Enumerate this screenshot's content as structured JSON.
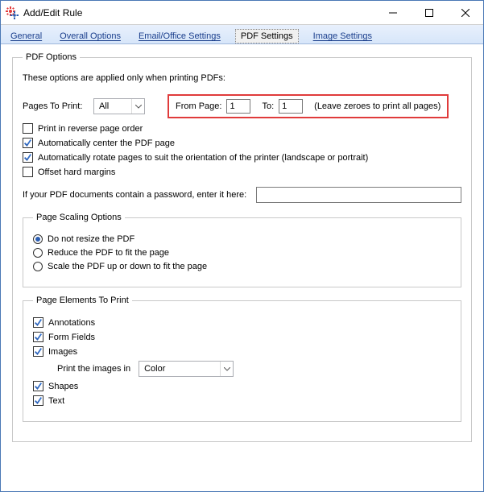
{
  "window": {
    "title": "Add/Edit Rule"
  },
  "tabs": {
    "general": "General",
    "overall": "Overall Options",
    "email": "Email/Office Settings",
    "pdf": "PDF Settings",
    "image": "Image Settings"
  },
  "pdf": {
    "group_title": "PDF Options",
    "intro": "These options are applied only when printing PDFs:",
    "pages_to_print_label": "Pages To Print:",
    "pages_to_print_value": "All",
    "from_label": "From Page:",
    "from_value": "1",
    "to_label": "To:",
    "to_value": "1",
    "range_hint": "(Leave zeroes to print all pages)",
    "reverse_label": "Print in reverse page order",
    "center_label": "Automatically center the PDF page",
    "rotate_label": "Automatically rotate pages to suit the orientation of the printer (landscape or portrait)",
    "offset_label": "Offset hard margins",
    "password_label": "If your PDF documents contain a password, enter it here:",
    "password_value": "",
    "scaling": {
      "group_title": "Page Scaling Options",
      "no_resize": "Do not resize the PDF",
      "reduce": "Reduce the PDF to fit the page",
      "scale": "Scale the PDF up or down to fit the page"
    },
    "elements": {
      "group_title": "Page Elements To Print",
      "annotations": "Annotations",
      "form_fields": "Form Fields",
      "images": "Images",
      "print_images_label": "Print the images in",
      "print_images_value": "Color",
      "shapes": "Shapes",
      "text": "Text"
    }
  }
}
